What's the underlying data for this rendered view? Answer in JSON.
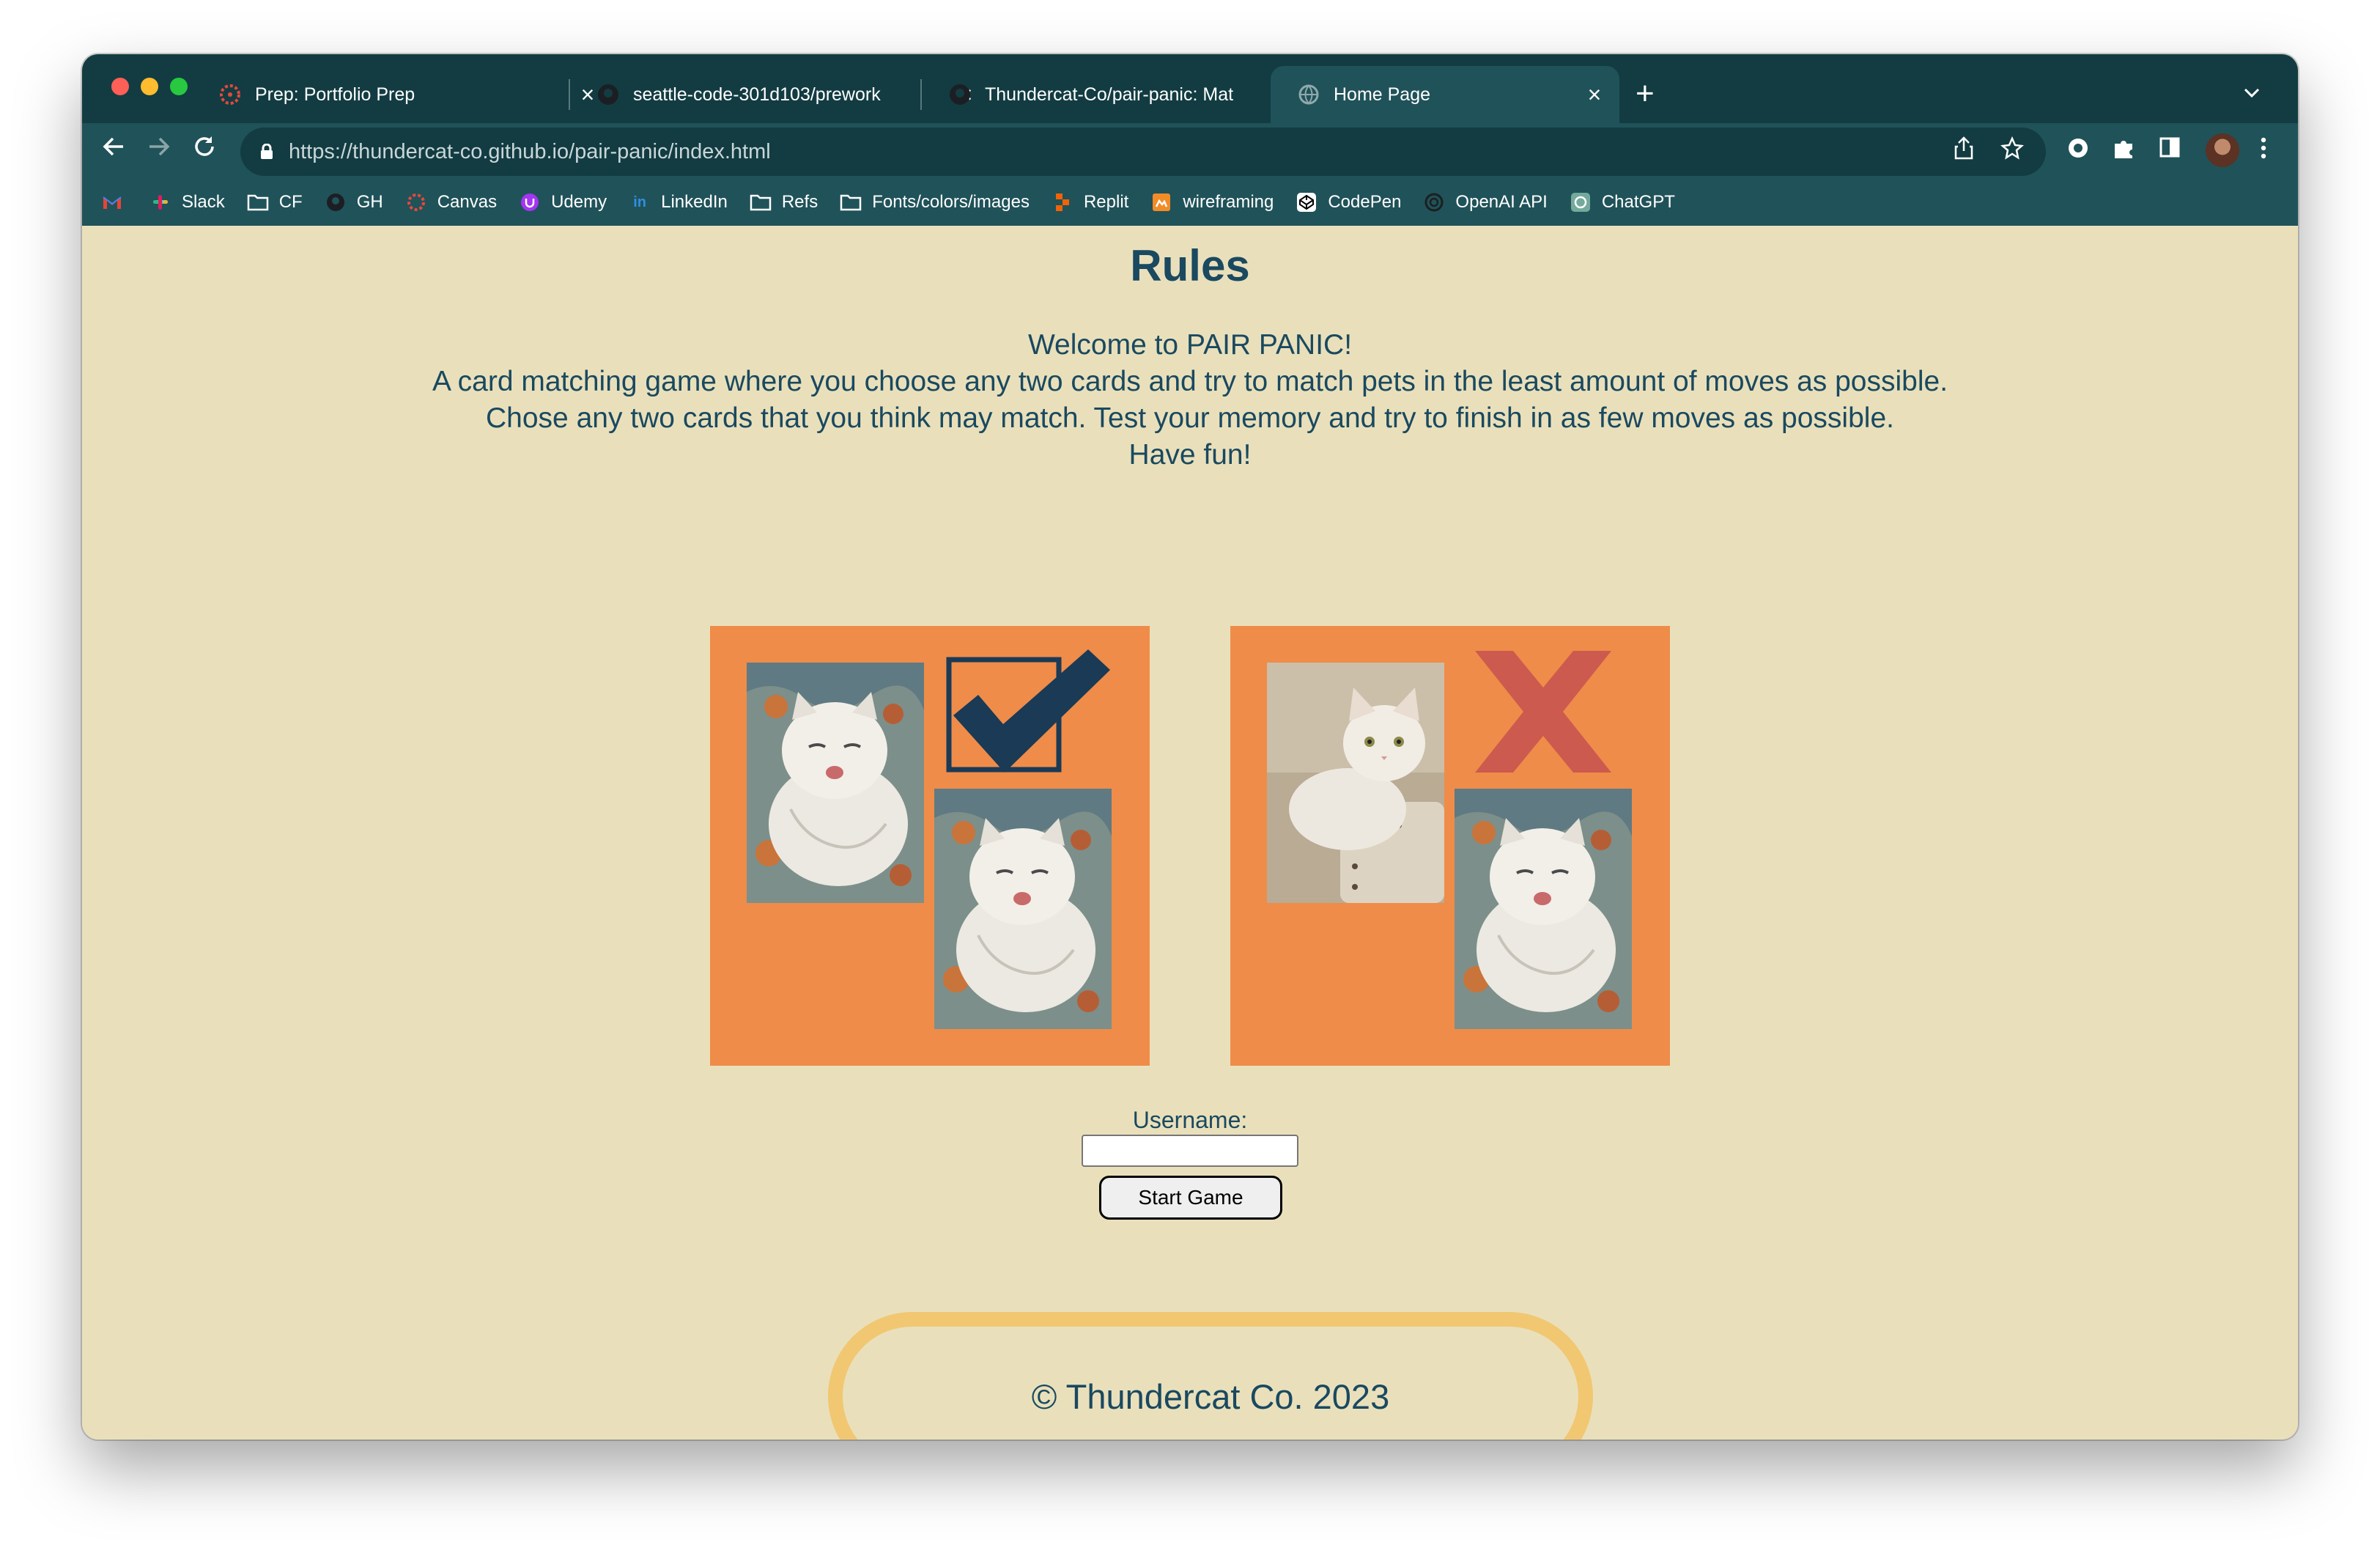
{
  "browser": {
    "tabs": [
      {
        "title": "Prep: Portfolio Prep",
        "active": false
      },
      {
        "title": "seattle-code-301d103/prework",
        "active": false
      },
      {
        "title": "Thundercat-Co/pair-panic: Mat",
        "active": false
      },
      {
        "title": "Home Page",
        "active": true
      }
    ],
    "url_host": "https://thundercat-co.github.io",
    "url_path": "/pair-panic/index.html",
    "bookmarks": [
      "Slack",
      "CF",
      "GH",
      "Canvas",
      "Udemy",
      "LinkedIn",
      "Refs",
      "Fonts/colors/images",
      "Replit",
      "wireframing",
      "CodePen",
      "OpenAI API",
      "ChatGPT"
    ]
  },
  "rules": {
    "title": "Rules",
    "lines": [
      "Welcome to PAIR PANIC!",
      "A card matching game where you choose any two cards and try to match pets in the least amount of moves as possible.",
      "Chose any two cards that you think may match. Test your memory and try to finish in as few moves as possible.",
      "Have fun!"
    ]
  },
  "form": {
    "username_label": "Username:",
    "username_value": "",
    "start_button": "Start Game"
  },
  "footer": {
    "text": "© Thundercat Co. 2023"
  },
  "colors": {
    "tab_bar": "#123c42",
    "toolbar": "#205259",
    "page_bg": "#e9e0bb",
    "text": "#1a4960",
    "card": "#ef8c49",
    "check": "#1a3a56",
    "cross": "#cc5a4f",
    "footer_border": "#f1c772"
  }
}
